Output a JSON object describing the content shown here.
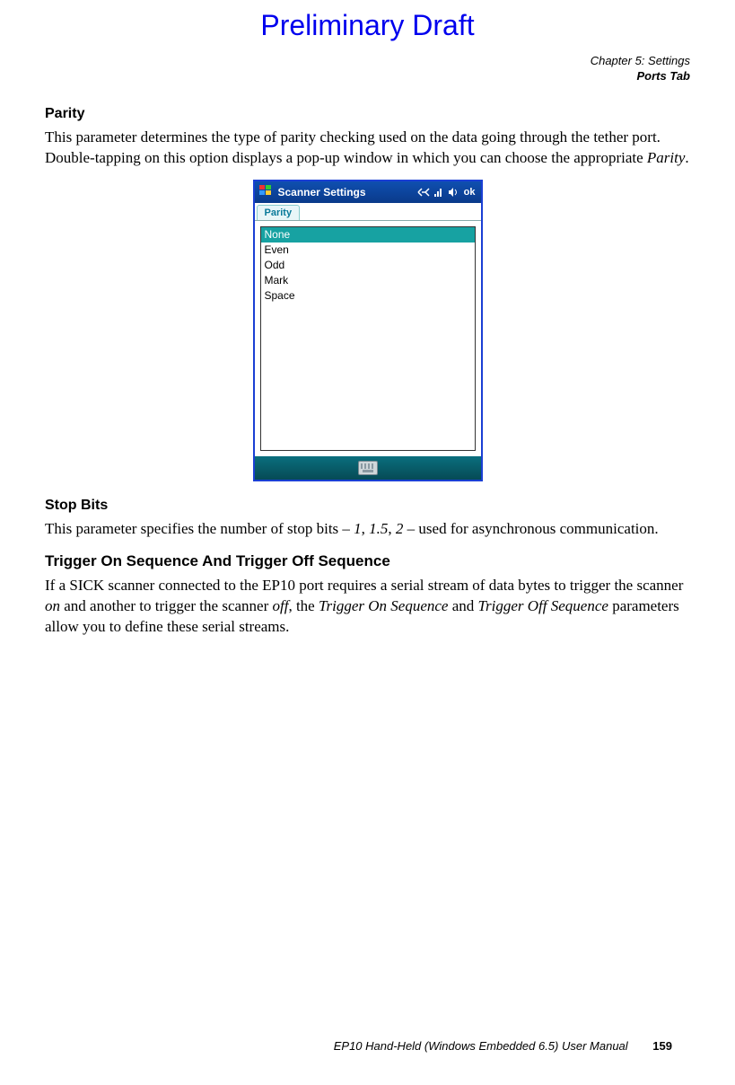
{
  "draft_banner": "Preliminary Draft",
  "header": {
    "chapter": "Chapter 5: Settings",
    "section": "Ports Tab"
  },
  "sections": {
    "parity": {
      "heading": "Parity",
      "text_a": "This parameter determines the type of parity checking used on the data going through the tether port. Double-tapping on this option displays a pop-up window in which you can choose the appropriate ",
      "text_b_italic": "Parity",
      "text_c": "."
    },
    "stop_bits": {
      "heading": "Stop Bits",
      "text_a": "This parameter specifies the number of stop bits – ",
      "v1": "1",
      "sep1": ", ",
      "v2": "1.5",
      "sep2": ", ",
      "v3": "2",
      "text_b": " – used for asynchronous communication."
    },
    "trigger": {
      "heading": "Trigger On Sequence And Trigger Off Sequence",
      "text_a": "If a SICK scanner connected to the EP10 port requires a serial stream of data bytes to trigger the scanner ",
      "on_i": "on",
      "text_b": " and another to trigger the scanner ",
      "off_i": "off",
      "text_c": ", the ",
      "tos_i": "Trigger On Sequence",
      "text_d": " and ",
      "tofs_i": "Trigger Off Sequence",
      "text_e": " parameters allow you to define these serial streams."
    }
  },
  "screenshot": {
    "title": "Scanner Settings",
    "ok_label": "ok",
    "tab_label": "Parity",
    "options": [
      "None",
      "Even",
      "Odd",
      "Mark",
      "Space"
    ],
    "selected_index": 0,
    "icons": {
      "start": "windows-flag-icon",
      "conn": "connectivity-icon",
      "signal": "signal-icon",
      "volume": "volume-icon",
      "keyboard": "keyboard-icon"
    }
  },
  "footer": {
    "manual": "EP10 Hand-Held (Windows Embedded 6.5) User Manual",
    "page": "159"
  }
}
